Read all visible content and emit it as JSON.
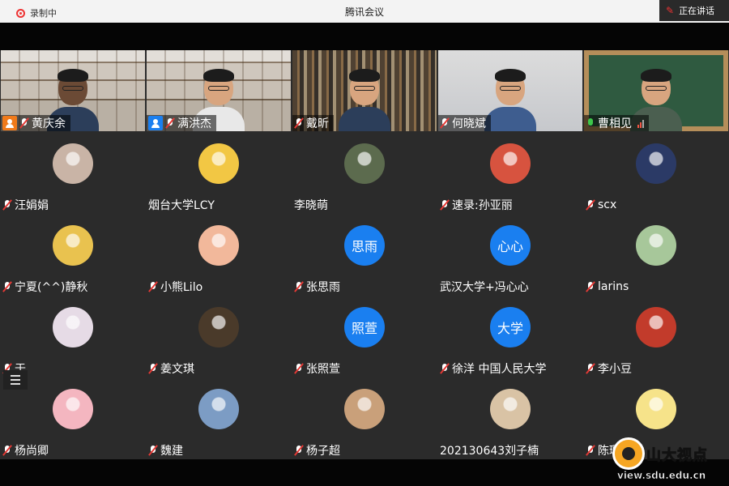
{
  "window": {
    "title": "腾讯会议",
    "speaking_label": "正在讲话"
  },
  "recording_label": "录制中",
  "participants": [
    {
      "name": "黄庆余",
      "kind": "video",
      "bg": "shelf",
      "person": "dark",
      "badge": "host",
      "mic": "off"
    },
    {
      "name": "满洪杰",
      "kind": "video",
      "bg": "shelf",
      "person": "white",
      "badge": "cohost",
      "mic": "off"
    },
    {
      "name": "戴昕",
      "kind": "video",
      "bg": "books",
      "person": "",
      "badge": "",
      "mic": "off"
    },
    {
      "name": "何晓斌",
      "kind": "video",
      "bg": "plain",
      "person": "blue",
      "badge": "",
      "mic": "off"
    },
    {
      "name": "曹相见",
      "kind": "video",
      "bg": "board",
      "person": "green",
      "badge": "",
      "mic": "on",
      "signal": true
    },
    {
      "name": "汪娟娟",
      "kind": "avatar",
      "avatar_color": "#c9b4a6",
      "mic": "off"
    },
    {
      "name": "烟台大学LCY",
      "kind": "avatar",
      "avatar_color": "#f2c744",
      "mic": "none"
    },
    {
      "name": "李晓萌",
      "kind": "avatar",
      "avatar_color": "#5c6b4e",
      "mic": "none"
    },
    {
      "name": "速录:孙亚丽",
      "kind": "avatar",
      "avatar_color": "#d7533f",
      "mic": "off"
    },
    {
      "name": "scx",
      "kind": "avatar",
      "avatar_color": "#2b3a66",
      "mic": "off"
    },
    {
      "name": "宁夏(^^)静秋",
      "kind": "avatar",
      "avatar_color": "#e9c24f",
      "mic": "off"
    },
    {
      "name": "小熊Lilo",
      "kind": "avatar",
      "avatar_color": "#f2b89b",
      "mic": "off"
    },
    {
      "name": "张思雨",
      "kind": "text",
      "avatar_text": "思雨",
      "mic": "off"
    },
    {
      "name": "武汉大学+冯心心",
      "kind": "text",
      "avatar_text": "心心",
      "mic": "none"
    },
    {
      "name": "larins",
      "kind": "avatar",
      "avatar_color": "#a7c79a",
      "mic": "off"
    },
    {
      "name": "于",
      "kind": "avatar",
      "avatar_color": "#e6dbe6",
      "mic": "off"
    },
    {
      "name": "姜文琪",
      "kind": "avatar",
      "avatar_color": "#4a3a2a",
      "mic": "off"
    },
    {
      "name": "张照萱",
      "kind": "text",
      "avatar_text": "照萱",
      "mic": "off"
    },
    {
      "name": "徐洋 中国人民大学",
      "kind": "text",
      "avatar_text": "大学",
      "mic": "off"
    },
    {
      "name": "李小豆",
      "kind": "avatar",
      "avatar_color": "#c23b2b",
      "mic": "off"
    },
    {
      "name": "杨尚卿",
      "kind": "avatar",
      "avatar_color": "#f4b6c0",
      "mic": "off"
    },
    {
      "name": "魏建",
      "kind": "avatar",
      "avatar_color": "#7c9cc4",
      "mic": "off"
    },
    {
      "name": "杨子超",
      "kind": "avatar",
      "avatar_color": "#c9a07a",
      "mic": "off"
    },
    {
      "name": "202130643刘子楠",
      "kind": "avatar",
      "avatar_color": "#d9c3a5",
      "mic": "none"
    },
    {
      "name": "陈璐鹭",
      "kind": "avatar",
      "avatar_color": "#f6e38a",
      "mic": "off"
    }
  ],
  "watermark": {
    "name": "山大视点",
    "url": "view.sdu.edu.cn"
  }
}
